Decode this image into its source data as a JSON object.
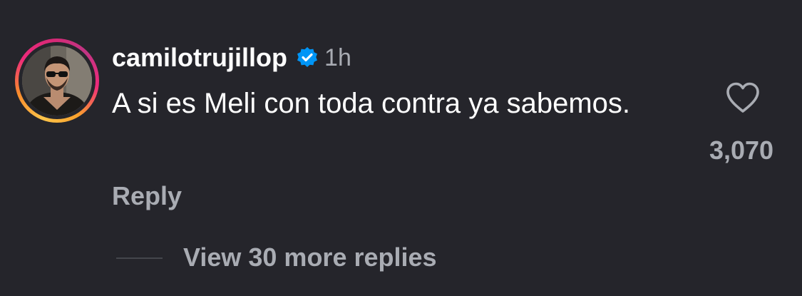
{
  "comment": {
    "username": "camilotrujillop",
    "verified": true,
    "time": "1h",
    "text": "A si es Meli con toda contra ya sabemos.",
    "reply_label": "Reply",
    "like_count": "3,070",
    "view_replies_label": "View 30 more replies"
  },
  "icons": {
    "avatar": "profile-photo",
    "verified": "verified-badge-icon",
    "like": "heart-outline-icon"
  },
  "colors": {
    "background": "#25252b",
    "primary_text": "#ffffff",
    "secondary_text": "#a9acb3",
    "verified_blue": "#0095f6"
  }
}
